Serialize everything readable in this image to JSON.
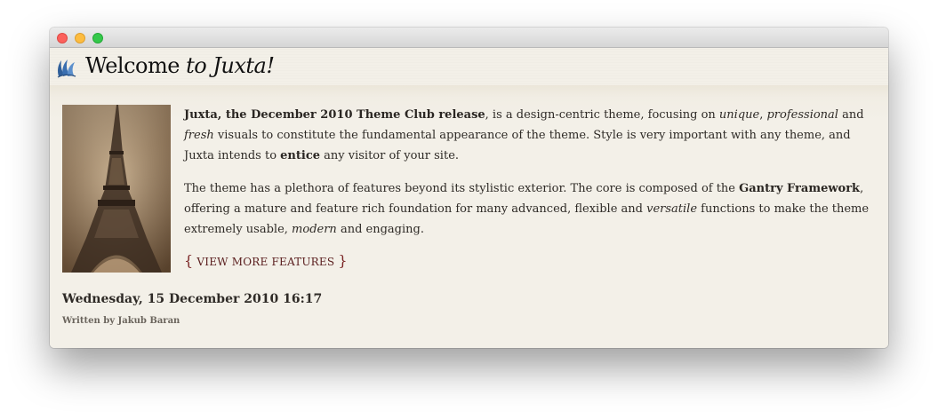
{
  "window": {
    "controls": [
      "close",
      "minimize",
      "maximize"
    ]
  },
  "header": {
    "logo_icon": "juxta-flame-icon",
    "title_plain": "Welcome ",
    "title_italic": "to Juxta!"
  },
  "article": {
    "image_alt": "eiffel-tower-photo",
    "p1": [
      {
        "text": "Juxta, the December 2010 Theme Club release",
        "style": "b"
      },
      {
        "text": ", is a design-centric theme, focusing on ",
        "style": ""
      },
      {
        "text": "unique",
        "style": "i"
      },
      {
        "text": ", ",
        "style": ""
      },
      {
        "text": "professional",
        "style": "i"
      },
      {
        "text": " and ",
        "style": ""
      },
      {
        "text": "fresh",
        "style": "i"
      },
      {
        "text": " visuals to constitute the fundamental appearance of the theme. Style is very important with any theme, and Juxta intends to ",
        "style": ""
      },
      {
        "text": "entice",
        "style": "b"
      },
      {
        "text": " any visitor of your site.",
        "style": ""
      }
    ],
    "p2": [
      {
        "text": "The theme has a plethora of features beyond its stylistic exterior. The core is composed of the ",
        "style": ""
      },
      {
        "text": "Gantry Framework",
        "style": "b"
      },
      {
        "text": ", offering a mature and feature rich foundation for many advanced, flexible and ",
        "style": ""
      },
      {
        "text": "versatile",
        "style": "i"
      },
      {
        "text": " functions to make the theme extremely usable, ",
        "style": ""
      },
      {
        "text": "modern",
        "style": "i"
      },
      {
        "text": " and engaging.",
        "style": ""
      }
    ],
    "read_more": {
      "open_brace": "{",
      "label": "VIEW MORE FEATURES",
      "close_brace": "}"
    }
  },
  "meta": {
    "date": "Wednesday, 15 December 2010 16:17",
    "author": "Written by Jakub Baran"
  },
  "colors": {
    "accent": "#5a1e1e",
    "logo_blue": "#2f5f9a"
  }
}
